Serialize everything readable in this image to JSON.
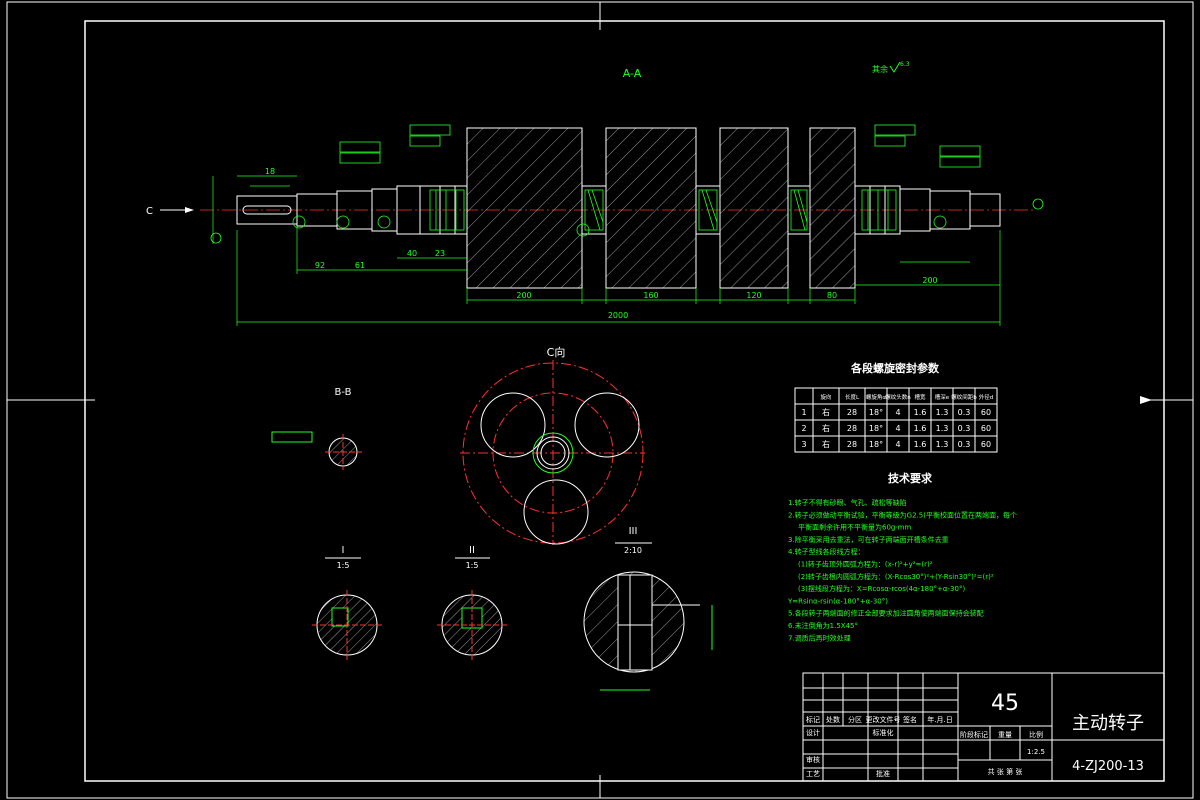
{
  "drawing": {
    "section_aa_label": "A-A",
    "view_c_label": "C向",
    "section_bb_label": "B-B",
    "detail_1_label": "I",
    "detail_1_scale": "1:5",
    "detail_2_label": "II",
    "detail_2_scale": "1:5",
    "detail_3_label": "III",
    "detail_3_scale": "2:10",
    "arrow_c_label": "C",
    "rest_roughness": "其余",
    "roughness_value": "6.3"
  },
  "spiral_table": {
    "title": "各段螺旋密封参数",
    "headers": [
      "",
      "旋向",
      "长度L",
      "螺旋角α",
      "螺纹头数n",
      "槽宽",
      "槽深e",
      "螺纹间距b",
      "外径d"
    ],
    "rows": [
      [
        "1",
        "右",
        "28",
        "18°",
        "4",
        "1.6",
        "1.3",
        "0.3",
        "60"
      ],
      [
        "2",
        "右",
        "28",
        "18°",
        "4",
        "1.6",
        "1.3",
        "0.3",
        "60"
      ],
      [
        "3",
        "右",
        "28",
        "18°",
        "4",
        "1.6",
        "1.3",
        "0.3",
        "60"
      ]
    ]
  },
  "tech_req": {
    "title": "技术要求",
    "lines": [
      "1.转子不得有砂眼、气孔、疏松等缺陷",
      "2.转子必须做动平衡试验，平衡等级为G2.5(平衡校面位置在两端面，每个",
      "平衡面剩余许用不平衡量为60g·mm",
      "3.除平衡采用去重法，可在转子两端面开槽条件去重",
      "4.转子型线各段线方程：",
      "(1)转子齿顶外圆弧方程为：(x-r)²+y²=(r)²",
      "(2)转子齿根内圆弧方程为：(X-Rcos30°)²+(Y-Rsin30°)²=(r)²",
      "(3)摆线段方程为：X=Rcosα-rcos(4α-180°+α-30°)",
      "Y=Rsinα-rsin(α-180°+α-30°)",
      "5.各段转子两端面的修正全部要求加注圆角使两端面保持会装配",
      "6.未注倒角为1.5X45°",
      "7.调质后再时效处理"
    ]
  },
  "title_block": {
    "material": "45",
    "part_name": "主动转子",
    "drawing_no": "4-ZJ200-13",
    "scale_value": "1:2.5",
    "col_labels": [
      "标记",
      "处数",
      "分区",
      "更改文件号",
      "签名",
      "年.月.日"
    ],
    "row_labels": [
      "设计",
      "标准化",
      "审核",
      "工艺",
      "批准"
    ],
    "stage_label": "阶段标记",
    "weight_label": "重量",
    "scale_label": "比例",
    "sheets_label": "共 张 第 张"
  }
}
